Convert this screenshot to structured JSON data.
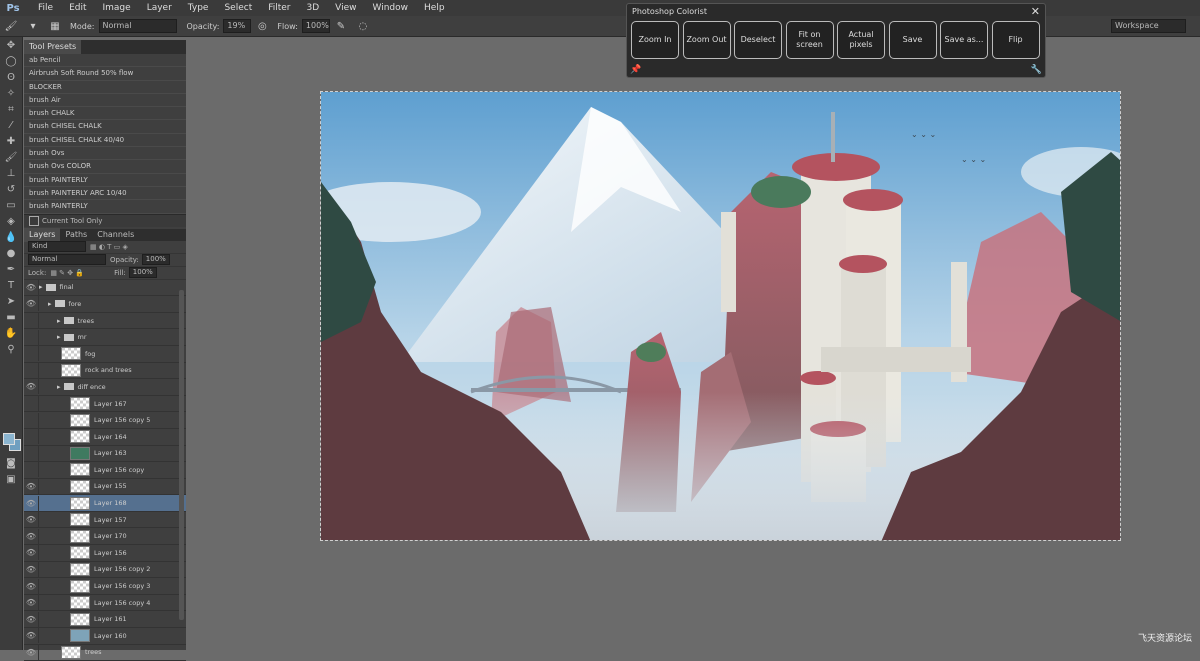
{
  "menubar": {
    "logo": "Ps",
    "items": [
      "File",
      "Edit",
      "Image",
      "Layer",
      "Type",
      "Select",
      "Filter",
      "3D",
      "View",
      "Window",
      "Help"
    ]
  },
  "options": {
    "mode_label": "Mode:",
    "mode_value": "Normal",
    "opacity_label": "Opacity:",
    "opacity_value": "19%",
    "flow_label": "Flow:",
    "flow_value": "100%",
    "workspace_value": "Workspace"
  },
  "tool_presets": {
    "title": "Tool Presets",
    "items": [
      "ab Pencil",
      "Airbrush Soft Round 50% flow",
      "BLOCKER",
      "brush Air",
      "brush CHALK",
      "brush CHISEL CHALK",
      "brush CHISEL CHALK 40/40",
      "brush Ovs",
      "brush Ovs COLOR",
      "brush PAINTERLY",
      "brush PAINTERLY ARC 10/40",
      "brush PAINTERLY"
    ],
    "footer_label": "Current Tool Only"
  },
  "layers": {
    "tabs": [
      "Layers",
      "Paths",
      "Channels"
    ],
    "filter_value": "Kind",
    "blend_value": "Normal",
    "opacity_label": "Opacity:",
    "opacity_value": "100%",
    "lock_label": "Lock:",
    "fill_label": "Fill:",
    "fill_value": "100%",
    "rows": [
      {
        "name": "final",
        "type": "folder",
        "indent": 0,
        "eye": true
      },
      {
        "name": "fore",
        "type": "folder",
        "indent": 1,
        "eye": true
      },
      {
        "name": "trees",
        "type": "folder",
        "indent": 2,
        "eye": false
      },
      {
        "name": "mr",
        "type": "folder",
        "indent": 2,
        "eye": false
      },
      {
        "name": "fog",
        "type": "layer",
        "indent": 2,
        "eye": false
      },
      {
        "name": "rock and trees",
        "type": "layer",
        "indent": 2,
        "eye": false
      },
      {
        "name": "diff ence",
        "type": "folder",
        "indent": 2,
        "eye": true
      },
      {
        "name": "Layer 167",
        "type": "layer",
        "indent": 3,
        "eye": false
      },
      {
        "name": "Layer 156 copy 5",
        "type": "layer",
        "indent": 3,
        "eye": false
      },
      {
        "name": "Layer 164",
        "type": "layer",
        "indent": 3,
        "eye": false
      },
      {
        "name": "Layer 163",
        "type": "layer",
        "indent": 3,
        "eye": false,
        "green": true
      },
      {
        "name": "Layer 156 copy",
        "type": "layer",
        "indent": 3,
        "eye": false
      },
      {
        "name": "Layer 155",
        "type": "layer",
        "indent": 3,
        "eye": true
      },
      {
        "name": "Layer 168",
        "type": "layer",
        "indent": 3,
        "eye": true,
        "selected": true
      },
      {
        "name": "Layer 157",
        "type": "layer",
        "indent": 3,
        "eye": true
      },
      {
        "name": "Layer 170",
        "type": "layer",
        "indent": 3,
        "eye": true
      },
      {
        "name": "Layer 156",
        "type": "layer",
        "indent": 3,
        "eye": true
      },
      {
        "name": "Layer 156 copy 2",
        "type": "layer",
        "indent": 3,
        "eye": true
      },
      {
        "name": "Layer 156 copy 3",
        "type": "layer",
        "indent": 3,
        "eye": true
      },
      {
        "name": "Layer 156 copy 4",
        "type": "layer",
        "indent": 3,
        "eye": true
      },
      {
        "name": "Layer 161",
        "type": "layer",
        "indent": 3,
        "eye": true
      },
      {
        "name": "Layer 160",
        "type": "layer",
        "indent": 3,
        "eye": true,
        "blue": true
      },
      {
        "name": "trees",
        "type": "layer",
        "indent": 2,
        "eye": true
      }
    ]
  },
  "colorist": {
    "title": "Photoshop Colorist",
    "buttons": [
      "Zoom In",
      "Zoom Out",
      "Deselect",
      "Fit on screen",
      "Actual pixels",
      "Save",
      "Save as...",
      "Flip"
    ]
  },
  "watermark": "飞天资源论坛"
}
